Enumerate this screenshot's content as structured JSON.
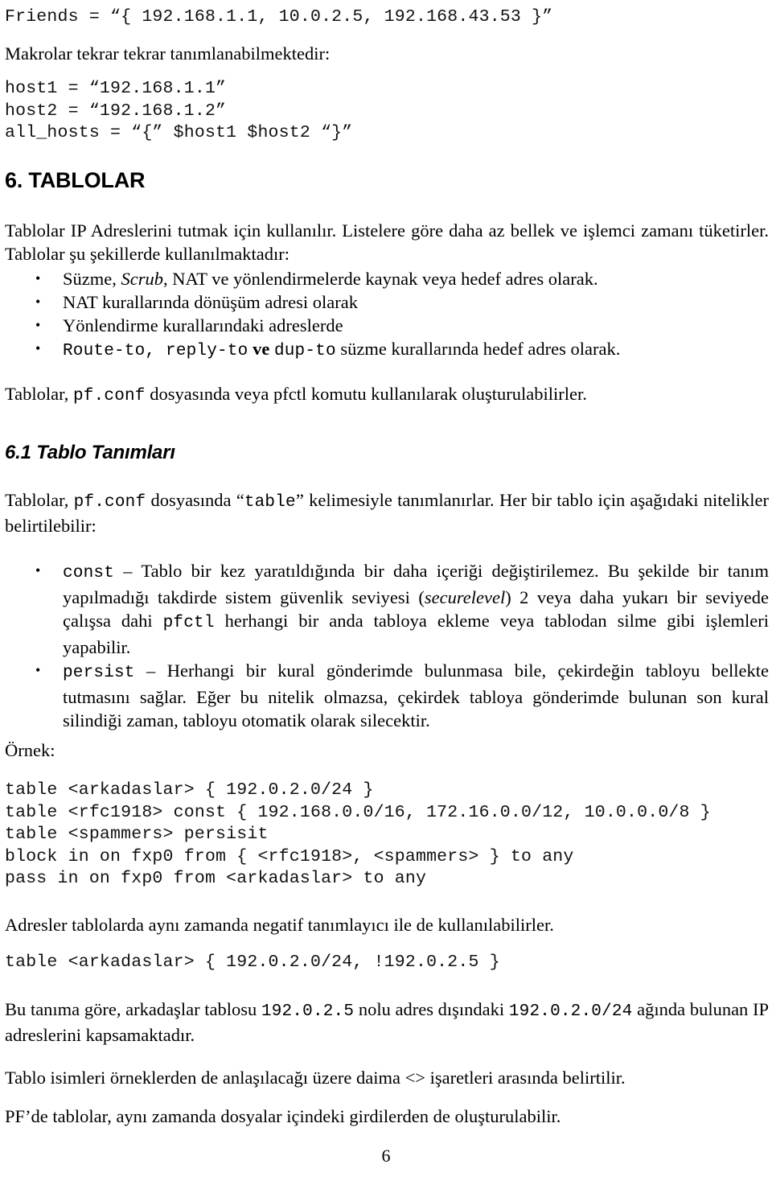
{
  "document": {
    "page_number": "6",
    "language": "tr"
  },
  "code_friends": "Friends = “{ 192.168.1.1, 10.0.2.5, 192.168.43.53 }”",
  "para_makrolar": "Makrolar tekrar tekrar tanımlanabilmektedir:",
  "code_hosts": "host1 = “192.168.1.1”\nhost2 = “192.168.1.2”\nall_hosts = “{” $host1 $host2 “}”",
  "heading_6": "6. TABLOLAR",
  "para_tablolar_intro": {
    "text": "Tablolar IP Adreslerini tutmak için kullanılır. Listelere göre daha az bellek ve işlemci zamanı tüketirler. Tablolar şu şekillerde kullanılmaktadır:"
  },
  "bullets_usage": [
    {
      "bullet": "•",
      "parts": [
        {
          "text": "Süzme, ",
          "style": "serif"
        },
        {
          "text": "Scrub",
          "style": "italic"
        },
        {
          "text": ", NAT ve yönlendirmelerde kaynak veya hedef adres olarak.",
          "style": "serif"
        }
      ]
    },
    {
      "bullet": "•",
      "parts": [
        {
          "text": "NAT kurallarında dönüşüm adresi olarak",
          "style": "serif"
        }
      ]
    },
    {
      "bullet": "•",
      "parts": [
        {
          "text": "Yönlendirme kurallarındaki adreslerde",
          "style": "serif"
        }
      ]
    },
    {
      "bullet": "•",
      "parts": [
        {
          "text": "Route-to, reply-to",
          "style": "mono"
        },
        {
          "text": " ve ",
          "style": "serif"
        },
        {
          "text": "dup-to",
          "style": "mono"
        },
        {
          "text": " süzme kurallarında hedef adres olarak.",
          "style": "serif"
        }
      ]
    }
  ],
  "para_tablolar_pfconf": {
    "before": "Tablolar, ",
    "code": "pf.conf",
    "after": " dosyasında veya pfctl komutu kullanılarak oluşturulabilirler."
  },
  "heading_6_1": "6.1 Tablo Tanımları",
  "para_tablo_tanim": {
    "p1": "Tablolar, ",
    "c1": "pf.conf",
    "p2": " dosyasında “",
    "c2": "table",
    "p3": "” kelimesiyle tanımlanırlar. Her bir tablo için aşağıdaki nitelikler belirtilebilir:"
  },
  "bullets_attributes": [
    {
      "bullet": "•",
      "parts": [
        {
          "text": "const",
          "style": "mono"
        },
        {
          "text": " – Tablo bir kez yaratıldığında bir daha içeriği değiştirilemez. Bu şekilde bir tanım yapılmadığı takdirde sistem güvenlik seviyesi (",
          "style": "serif"
        },
        {
          "text": "securelevel",
          "style": "italic"
        },
        {
          "text": ") 2 veya daha yukarı bir seviyede çalışsa dahi ",
          "style": "serif"
        },
        {
          "text": "pfctl",
          "style": "mono"
        },
        {
          "text": " herhangi bir anda tabloya ekleme veya tablodan silme gibi işlemleri yapabilir.",
          "style": "serif"
        }
      ]
    },
    {
      "bullet": "•",
      "parts": [
        {
          "text": "persist",
          "style": "mono"
        },
        {
          "text": " – Herhangi bir kural gönderimde bulunmasa bile, çekirdeğin tabloyu bellekte tutmasını sağlar. Eğer bu nitelik olmazsa, çekirdek tabloya gönderimde bulunan son kural silindiği zaman, tabloyu otomatik olarak silecektir.",
          "style": "serif"
        }
      ]
    }
  ],
  "label_ornek": "Örnek:",
  "code_table_examples": "table <arkadaslar> { 192.0.2.0/24 }\ntable <rfc1918> const { 192.168.0.0/16, 172.16.0.0/12, 10.0.0.0/8 }\ntable <spammers> persisit\nblock in on fxp0 from { <rfc1918>, <spammers> } to any\npass in on fxp0 from <arkadaslar> to any",
  "para_negatif": "Adresler tablolarda aynı zamanda negatif tanımlayıcı ile de kullanılabilirler.",
  "code_table_negatif": "table <arkadaslar> { 192.0.2.0/24, !192.0.2.5 }",
  "para_bu_tanima": {
    "p1": "Bu tanıma göre, arkadaşlar tablosu ",
    "c1": "192.0.2.5",
    "p2": " nolu adres dışındaki ",
    "c2": "192.0.2.0/24",
    "p3": " ağında bulunan IP adreslerini kapsamaktadır."
  },
  "para_tablo_isimleri": "Tablo isimleri örneklerden de anlaşılacağı üzere daima <>  işaretleri arasında belirtilir.",
  "para_pf_de_tablolar": "PF’de tablolar, aynı zamanda dosyalar içindeki girdilerden de oluşturulabilir."
}
